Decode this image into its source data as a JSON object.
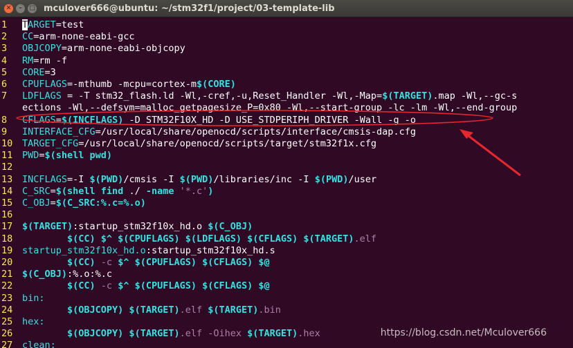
{
  "window": {
    "title": "mculover666@ubuntu: ~/stm32f1/project/03-template-lib"
  },
  "editor": {
    "lines": [
      {
        "num": "1",
        "segs": [
          [
            "cursor",
            "T"
          ],
          [
            "c-var",
            "ARGET"
          ],
          [
            "c-text",
            "=test"
          ]
        ]
      },
      {
        "num": "2",
        "segs": [
          [
            "c-var",
            "CC"
          ],
          [
            "c-text",
            "=arm-none-eabi-gcc"
          ]
        ]
      },
      {
        "num": "3",
        "segs": [
          [
            "c-var",
            "OBJCOPY"
          ],
          [
            "c-text",
            "=arm-none-eabi-objcopy"
          ]
        ]
      },
      {
        "num": "4",
        "segs": [
          [
            "c-var",
            "RM"
          ],
          [
            "c-text",
            "=rm -f"
          ]
        ]
      },
      {
        "num": "5",
        "segs": [
          [
            "c-var",
            "CORE"
          ],
          [
            "c-text",
            "=3"
          ]
        ]
      },
      {
        "num": "6",
        "segs": [
          [
            "c-var",
            "CPUFLAGS"
          ],
          [
            "c-text",
            "=-mthumb -mcpu=cortex-m"
          ],
          [
            "c-kw",
            "$(CORE)"
          ]
        ]
      },
      {
        "num": "7",
        "segs": [
          [
            "c-var",
            "LDFLAGS"
          ],
          [
            "c-text",
            " = -T stm32_flash.ld -Wl,-cref,-u,Reset_Handler -Wl,-Map="
          ],
          [
            "c-kw",
            "$(TARGET)"
          ],
          [
            "c-text",
            ".map -Wl,--gc-s"
          ]
        ]
      },
      {
        "num": "",
        "segs": [
          [
            "c-text",
            "ections -Wl,--defsym=malloc_getpagesize_P=0x80 -Wl,--start-group -lc -lm -Wl,--end-group"
          ]
        ]
      },
      {
        "num": "8",
        "segs": [
          [
            "c-var",
            "CFLAGS"
          ],
          [
            "c-text",
            "="
          ],
          [
            "c-kw",
            "$(INCFLAGS)"
          ],
          [
            "c-text",
            " -D STM32F10X_HD -D USE_STDPERIPH_DRIVER -Wall -g -o"
          ]
        ]
      },
      {
        "num": "9",
        "segs": [
          [
            "c-var",
            "INTERFACE_CFG"
          ],
          [
            "c-text",
            "=/usr/local/share/openocd/scripts/interface/cmsis-dap.cfg"
          ]
        ]
      },
      {
        "num": "10",
        "segs": [
          [
            "c-var",
            "TARGET_CFG"
          ],
          [
            "c-text",
            "=/usr/local/share/openocd/scripts/target/stm32f1x.cfg"
          ]
        ]
      },
      {
        "num": "11",
        "segs": [
          [
            "c-var",
            "PWD"
          ],
          [
            "c-text",
            "="
          ],
          [
            "c-kw",
            "$(shell pwd)"
          ]
        ]
      },
      {
        "num": "12",
        "segs": []
      },
      {
        "num": "13",
        "segs": [
          [
            "c-var",
            "INCFLAGS"
          ],
          [
            "c-text",
            "=-I "
          ],
          [
            "c-kw",
            "$(PWD)"
          ],
          [
            "c-text",
            "/cmsis -I "
          ],
          [
            "c-kw",
            "$(PWD)"
          ],
          [
            "c-text",
            "/libraries/inc -I "
          ],
          [
            "c-kw",
            "$(PWD)"
          ],
          [
            "c-text",
            "/user"
          ]
        ]
      },
      {
        "num": "14",
        "segs": [
          [
            "c-var",
            "C_SRC"
          ],
          [
            "c-text",
            "="
          ],
          [
            "c-kw",
            "$(shell find"
          ],
          [
            "c-text",
            " ./ "
          ],
          [
            "c-kw",
            "-name"
          ],
          [
            "c-text",
            " "
          ],
          [
            "c-str",
            "'*.c'"
          ],
          [
            "c-kw",
            ")"
          ]
        ]
      },
      {
        "num": "15",
        "segs": [
          [
            "c-var",
            "C_OBJ"
          ],
          [
            "c-text",
            "="
          ],
          [
            "c-kw",
            "$(C_SRC:%.c=%.o)"
          ]
        ]
      },
      {
        "num": "16",
        "segs": []
      },
      {
        "num": "17",
        "segs": [
          [
            "c-kw",
            "$(TARGET)"
          ],
          [
            "c-text",
            ":startup_stm32f10x_hd.o "
          ],
          [
            "c-kw",
            "$(C_OBJ)"
          ]
        ]
      },
      {
        "num": "18",
        "segs": [
          [
            "c-text",
            "        "
          ],
          [
            "c-kw",
            "$(CC) $^ $(CPUFLAGS) $(LDFLAGS) $(CFLAGS) $(TARGET)"
          ],
          [
            "c-str",
            ".elf"
          ]
        ]
      },
      {
        "num": "19",
        "segs": [
          [
            "c-var",
            "startup_stm32f10x_hd.o"
          ],
          [
            "c-text",
            ":startup_stm32f10x_hd.s"
          ]
        ]
      },
      {
        "num": "20",
        "segs": [
          [
            "c-text",
            "        "
          ],
          [
            "c-kw",
            "$(CC)"
          ],
          [
            "c-str",
            " -c "
          ],
          [
            "c-kw",
            "$^ $(CPUFLAGS) $(CFLAGS) $@"
          ]
        ]
      },
      {
        "num": "21",
        "segs": [
          [
            "c-kw",
            "$(C_OBJ)"
          ],
          [
            "c-text",
            ":%.o:%.c"
          ]
        ]
      },
      {
        "num": "22",
        "segs": [
          [
            "c-text",
            "        "
          ],
          [
            "c-kw",
            "$(CC)"
          ],
          [
            "c-str",
            " -c "
          ],
          [
            "c-kw",
            "$^ $(CPUFLAGS) $(CFLAGS) $@"
          ]
        ]
      },
      {
        "num": "23",
        "segs": [
          [
            "c-var",
            "bin:"
          ]
        ]
      },
      {
        "num": "24",
        "segs": [
          [
            "c-text",
            "        "
          ],
          [
            "c-kw",
            "$(OBJCOPY) $(TARGET)"
          ],
          [
            "c-str",
            ".elf "
          ],
          [
            "c-kw",
            "$(TARGET)"
          ],
          [
            "c-str",
            ".bin"
          ]
        ]
      },
      {
        "num": "25",
        "segs": [
          [
            "c-var",
            "hex:"
          ]
        ]
      },
      {
        "num": "26",
        "segs": [
          [
            "c-text",
            "        "
          ],
          [
            "c-kw",
            "$(OBJCOPY) $(TARGET)"
          ],
          [
            "c-str",
            ".elf -Oihex "
          ],
          [
            "c-kw",
            "$(TARGET)"
          ],
          [
            "c-str",
            ".hex"
          ]
        ]
      },
      {
        "num": "27",
        "segs": [
          [
            "c-var",
            "clean:"
          ]
        ]
      }
    ]
  },
  "watermark": "https://blog.csdn.net/Mculover666",
  "colors": {
    "background": "#300a24",
    "line_number": "#fce94f",
    "variable": "#34e2e2",
    "string": "#ad7fa8",
    "annotation": "#e8262d"
  }
}
